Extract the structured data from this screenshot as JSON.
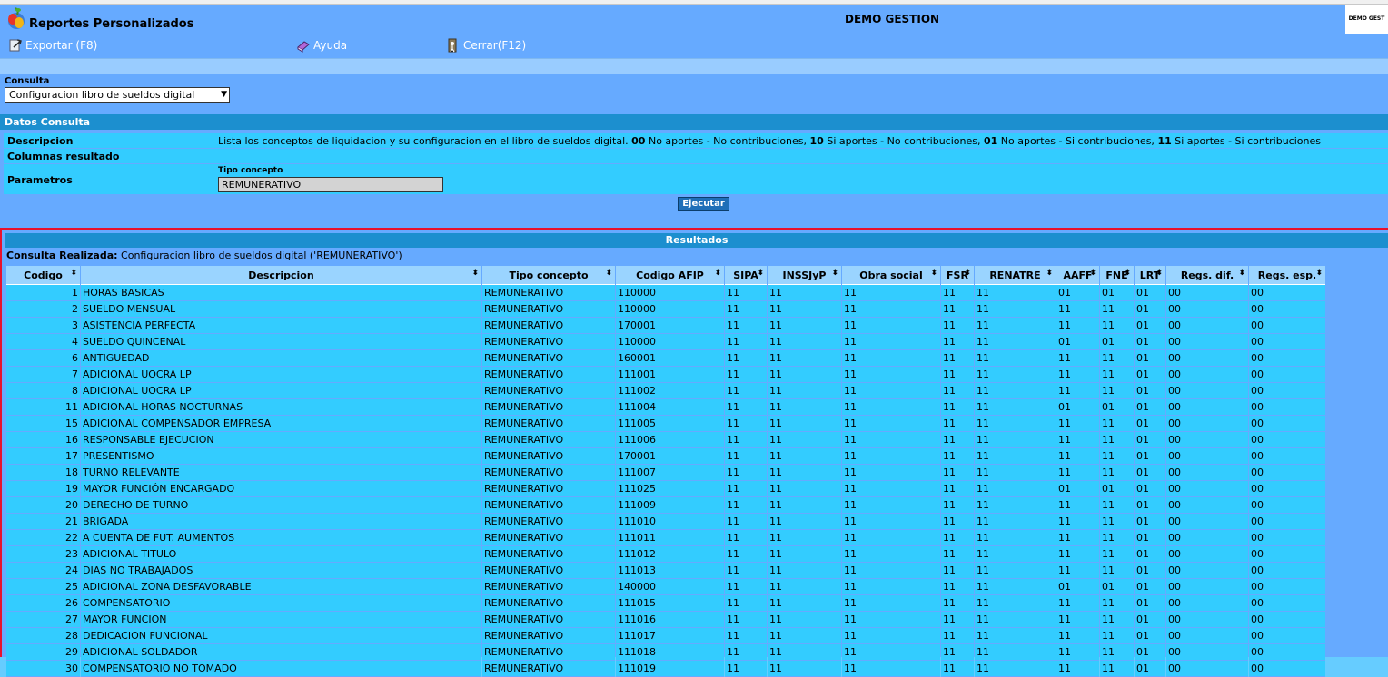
{
  "window": {
    "app_title": "Reportes Personalizados",
    "company": "DEMO GESTION",
    "corner_text": "DEMO GEST"
  },
  "toolbar": {
    "export_label": "Exportar (F8)",
    "help_label": "Ayuda",
    "close_label": "Cerrar(F12)"
  },
  "consulta": {
    "label": "Consulta",
    "selected": "Configuracion libro de sueldos digital"
  },
  "datos": {
    "header": "Datos Consulta",
    "descripcion_label": "Descripcion",
    "descripcion_value": [
      {
        "text": "Lista los conceptos de liquidacion y su configuracion en el libro de sueldos digital. ",
        "bold": false
      },
      {
        "text": "00",
        "bold": true
      },
      {
        "text": " No aportes - No contribuciones, ",
        "bold": false
      },
      {
        "text": "10",
        "bold": true
      },
      {
        "text": " Si aportes - No contribuciones, ",
        "bold": false
      },
      {
        "text": "01",
        "bold": true
      },
      {
        "text": " No aportes - Si contribuciones, ",
        "bold": false
      },
      {
        "text": "11",
        "bold": true
      },
      {
        "text": " Si aportes - Si contribuciones",
        "bold": false
      }
    ],
    "columnas_label": "Columnas resultado",
    "parametros_label": "Parametros",
    "param_name": "Tipo concepto",
    "param_value": "REMUNERATIVO",
    "execute_label": "Ejecutar"
  },
  "resultados": {
    "header": "Resultados",
    "consulta_label": "Consulta Realizada:",
    "consulta_value": "Configuracion libro de sueldos digital ('REMUNERATIVO')",
    "columns": [
      "Codigo",
      "Descripcion",
      "Tipo concepto",
      "Codigo AFIP",
      "SIPA",
      "INSSJyP",
      "Obra social",
      "FSR",
      "RENATRE",
      "AAFF",
      "FNE",
      "LRT",
      "Regs. dif.",
      "Regs. esp."
    ],
    "rows": [
      [
        "1",
        "HORAS BASICAS",
        "REMUNERATIVO",
        "110000",
        "11",
        "11",
        "11",
        "11",
        "11",
        "01",
        "01",
        "01",
        "00",
        "00"
      ],
      [
        "2",
        "SUELDO MENSUAL",
        "REMUNERATIVO",
        "110000",
        "11",
        "11",
        "11",
        "11",
        "11",
        "11",
        "11",
        "01",
        "00",
        "00"
      ],
      [
        "3",
        "ASISTENCIA PERFECTA",
        "REMUNERATIVO",
        "170001",
        "11",
        "11",
        "11",
        "11",
        "11",
        "11",
        "11",
        "01",
        "00",
        "00"
      ],
      [
        "4",
        "SUELDO QUINCENAL",
        "REMUNERATIVO",
        "110000",
        "11",
        "11",
        "11",
        "11",
        "11",
        "01",
        "01",
        "01",
        "00",
        "00"
      ],
      [
        "6",
        "ANTIGUEDAD",
        "REMUNERATIVO",
        "160001",
        "11",
        "11",
        "11",
        "11",
        "11",
        "11",
        "11",
        "01",
        "00",
        "00"
      ],
      [
        "7",
        "ADICIONAL UOCRA LP",
        "REMUNERATIVO",
        "111001",
        "11",
        "11",
        "11",
        "11",
        "11",
        "11",
        "11",
        "01",
        "00",
        "00"
      ],
      [
        "8",
        "ADICIONAL UOCRA LP",
        "REMUNERATIVO",
        "111002",
        "11",
        "11",
        "11",
        "11",
        "11",
        "11",
        "11",
        "01",
        "00",
        "00"
      ],
      [
        "11",
        "ADICIONAL HORAS NOCTURNAS",
        "REMUNERATIVO",
        "111004",
        "11",
        "11",
        "11",
        "11",
        "11",
        "01",
        "01",
        "01",
        "00",
        "00"
      ],
      [
        "15",
        "ADICIONAL COMPENSADOR EMPRESA",
        "REMUNERATIVO",
        "111005",
        "11",
        "11",
        "11",
        "11",
        "11",
        "11",
        "11",
        "01",
        "00",
        "00"
      ],
      [
        "16",
        "RESPONSABLE EJECUCION",
        "REMUNERATIVO",
        "111006",
        "11",
        "11",
        "11",
        "11",
        "11",
        "11",
        "11",
        "01",
        "00",
        "00"
      ],
      [
        "17",
        "PRESENTISMO",
        "REMUNERATIVO",
        "170001",
        "11",
        "11",
        "11",
        "11",
        "11",
        "11",
        "11",
        "01",
        "00",
        "00"
      ],
      [
        "18",
        "TURNO RELEVANTE",
        "REMUNERATIVO",
        "111007",
        "11",
        "11",
        "11",
        "11",
        "11",
        "11",
        "11",
        "01",
        "00",
        "00"
      ],
      [
        "19",
        "MAYOR FUNCIÓN ENCARGADO",
        "REMUNERATIVO",
        "111025",
        "11",
        "11",
        "11",
        "11",
        "11",
        "01",
        "01",
        "01",
        "00",
        "00"
      ],
      [
        "20",
        "DERECHO DE TURNO",
        "REMUNERATIVO",
        "111009",
        "11",
        "11",
        "11",
        "11",
        "11",
        "11",
        "11",
        "01",
        "00",
        "00"
      ],
      [
        "21",
        "BRIGADA",
        "REMUNERATIVO",
        "111010",
        "11",
        "11",
        "11",
        "11",
        "11",
        "11",
        "11",
        "01",
        "00",
        "00"
      ],
      [
        "22",
        "A CUENTA DE FUT. AUMENTOS",
        "REMUNERATIVO",
        "111011",
        "11",
        "11",
        "11",
        "11",
        "11",
        "11",
        "11",
        "01",
        "00",
        "00"
      ],
      [
        "23",
        "ADICIONAL  TITULO",
        "REMUNERATIVO",
        "111012",
        "11",
        "11",
        "11",
        "11",
        "11",
        "11",
        "11",
        "01",
        "00",
        "00"
      ],
      [
        "24",
        "DIAS NO TRABAJADOS",
        "REMUNERATIVO",
        "111013",
        "11",
        "11",
        "11",
        "11",
        "11",
        "11",
        "11",
        "01",
        "00",
        "00"
      ],
      [
        "25",
        "ADICIONAL ZONA DESFAVORABLE",
        "REMUNERATIVO",
        "140000",
        "11",
        "11",
        "11",
        "11",
        "11",
        "01",
        "01",
        "01",
        "00",
        "00"
      ],
      [
        "26",
        "COMPENSATORIO",
        "REMUNERATIVO",
        "111015",
        "11",
        "11",
        "11",
        "11",
        "11",
        "11",
        "11",
        "01",
        "00",
        "00"
      ],
      [
        "27",
        "MAYOR FUNCION",
        "REMUNERATIVO",
        "111016",
        "11",
        "11",
        "11",
        "11",
        "11",
        "11",
        "11",
        "01",
        "00",
        "00"
      ],
      [
        "28",
        "DEDICACION FUNCIONAL",
        "REMUNERATIVO",
        "111017",
        "11",
        "11",
        "11",
        "11",
        "11",
        "11",
        "11",
        "01",
        "00",
        "00"
      ],
      [
        "29",
        "ADICIONAL SOLDADOR",
        "REMUNERATIVO",
        "111018",
        "11",
        "11",
        "11",
        "11",
        "11",
        "11",
        "11",
        "01",
        "00",
        "00"
      ],
      [
        "30",
        "COMPENSATORIO NO TOMADO",
        "REMUNERATIVO",
        "111019",
        "11",
        "11",
        "11",
        "11",
        "11",
        "11",
        "11",
        "01",
        "00",
        "00"
      ]
    ]
  },
  "colors": {
    "background": "#66aaff",
    "row": "#33ccff",
    "header_band": "#1c8fcf",
    "accent_line": "#e8112d"
  },
  "icons": {
    "logo": "app-logo-icon",
    "export": "export-icon",
    "help": "book-icon",
    "close": "exit-icon",
    "sort": "sort-arrows-icon"
  }
}
